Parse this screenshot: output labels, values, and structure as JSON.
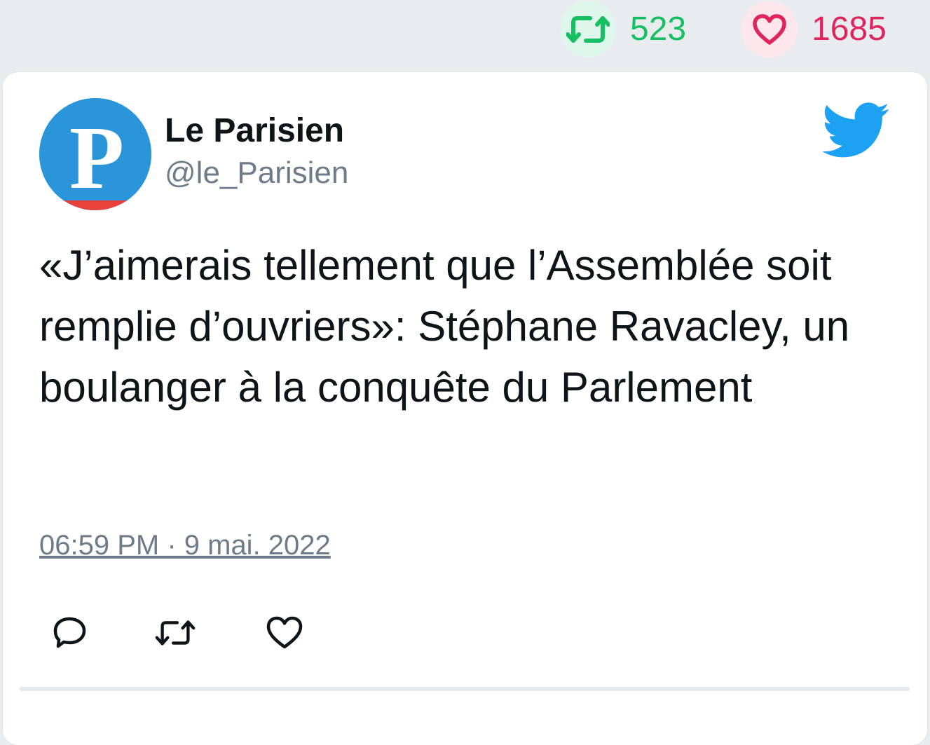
{
  "stats": {
    "retweet_count": "523",
    "like_count": "1685"
  },
  "author": {
    "name": "Le Parisien",
    "handle": "@le_Parisien",
    "avatar_letter": "P"
  },
  "tweet": {
    "text": "«J’aimerais tellement que l’Assemblée soit remplie d’ouvriers»: Stéphane Ravacley, un boulanger à la conquête du Parlement",
    "timestamp": "06:59 PM · 9 mai. 2022"
  },
  "icons": {
    "retweet": "retweet-icon",
    "like": "heart-icon",
    "reply": "reply-icon",
    "brand": "twitter-bird-icon"
  },
  "colors": {
    "retweet_green": "#17bf63",
    "like_red": "#e0245e",
    "twitter_blue": "#1da1f2",
    "avatar_blue": "#2a96d9",
    "avatar_red_band": "#e8403a",
    "handle_gray": "#6e7c89"
  }
}
